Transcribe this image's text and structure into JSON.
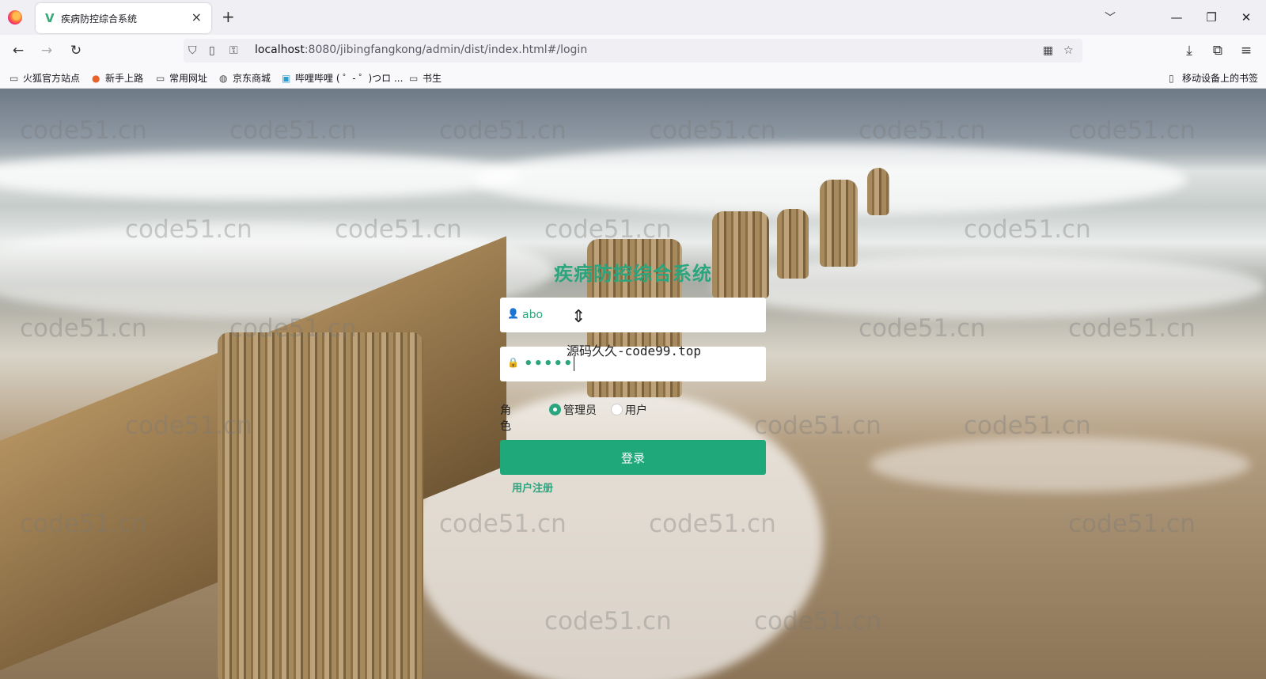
{
  "browser": {
    "tab_title": "疾病防控综合系统",
    "tab_close": "×",
    "new_tab": "+",
    "tab_list": "﹀",
    "window_minimize": "—",
    "window_restore": "❐",
    "window_close": "✕"
  },
  "nav": {
    "back": "←",
    "forward": "→",
    "reload": "↻",
    "url_host": "localhost",
    "url_rest": ":8080/jibingfangkong/admin/dist/index.html#/login"
  },
  "bookmarks": [
    {
      "label": "火狐官方站点",
      "icon": "folder-icon"
    },
    {
      "label": "新手上路",
      "icon": "firefox-icon"
    },
    {
      "label": "常用网址",
      "icon": "folder-icon"
    },
    {
      "label": "京东商城",
      "icon": "globe-icon"
    },
    {
      "label": "哔哩哔哩 ( ゜- ゜)つロ ...",
      "icon": "bilibili-icon"
    },
    {
      "label": "书生",
      "icon": "folder-icon"
    }
  ],
  "mobile_bookmarks": "移动设备上的书签",
  "watermark_text": "code51.cn",
  "overlay_text": "源码久久-code99.top",
  "login": {
    "title": "疾病防控综合系统",
    "username_value": "abo",
    "password_dots": "•••••",
    "role_label": "角色",
    "roles": [
      {
        "label": "管理员",
        "checked": true
      },
      {
        "label": "用户",
        "checked": false
      }
    ],
    "submit_label": "登录",
    "register_label": "用户注册"
  },
  "colors": {
    "accent": "#1fa87a",
    "title": "#2aa57d"
  }
}
